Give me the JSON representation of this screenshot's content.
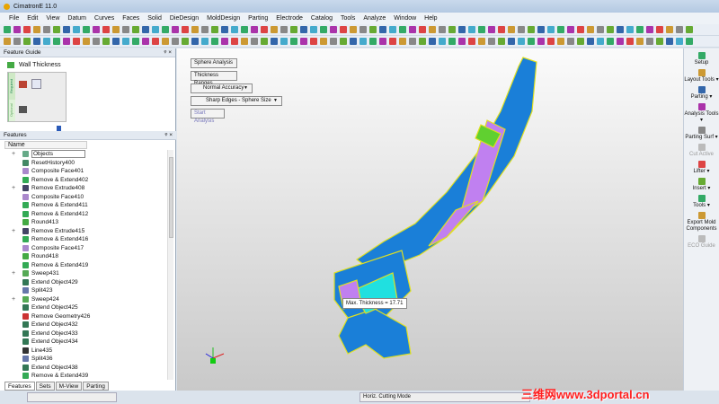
{
  "title": "CimatronE 11.0",
  "menu": [
    "File",
    "Edit",
    "View",
    "Datum",
    "Curves",
    "Faces",
    "Solid",
    "DieDesign",
    "MoldDesign",
    "Parting",
    "Electrode",
    "Catalog",
    "Tools",
    "Analyze",
    "Window",
    "Help"
  ],
  "feature_guide": {
    "title": "Feature Guide",
    "pin": "ᵠ ×",
    "tool": "Wall Thickness",
    "required": "Required",
    "optional": "Optional"
  },
  "features": {
    "title": "Features",
    "pin": "ᵠ ×",
    "column": "Name",
    "items": [
      {
        "label": "Objects",
        "expand": true,
        "color": "#6a8"
      },
      {
        "label": "ResetHistory400",
        "color": "#486"
      },
      {
        "label": "Composite Face401",
        "color": "#a8c"
      },
      {
        "label": "Remove & Extend402",
        "color": "#3a5"
      },
      {
        "label": "Remove Extrude408",
        "expand": true,
        "color": "#446"
      },
      {
        "label": "Composite Face410",
        "color": "#a8c"
      },
      {
        "label": "Remove & Extend411",
        "color": "#3a5"
      },
      {
        "label": "Remove & Extend412",
        "color": "#3a5"
      },
      {
        "label": "Round413",
        "color": "#4a4"
      },
      {
        "label": "Remove Extrude415",
        "expand": true,
        "color": "#446"
      },
      {
        "label": "Remove & Extend416",
        "color": "#3a5"
      },
      {
        "label": "Composite Face417",
        "color": "#a8c"
      },
      {
        "label": "Round418",
        "color": "#4a4"
      },
      {
        "label": "Remove & Extend419",
        "color": "#3a5"
      },
      {
        "label": "Sweep431",
        "expand": true,
        "color": "#5a5"
      },
      {
        "label": "Extend Object429",
        "color": "#375"
      },
      {
        "label": "Split423",
        "color": "#67a"
      },
      {
        "label": "Sweep424",
        "expand": true,
        "color": "#5a5"
      },
      {
        "label": "Extend Object425",
        "color": "#375"
      },
      {
        "label": "Remove Geometry426",
        "color": "#c33"
      },
      {
        "label": "Extend Object432",
        "color": "#375"
      },
      {
        "label": "Extend Object433",
        "color": "#375"
      },
      {
        "label": "Extend Object434",
        "color": "#375"
      },
      {
        "label": "Line435",
        "color": "#333"
      },
      {
        "label": "Split436",
        "color": "#67a"
      },
      {
        "label": "Extend Object438",
        "color": "#375"
      },
      {
        "label": "Remove & Extend439",
        "color": "#3a5"
      }
    ]
  },
  "tabs": [
    "Features",
    "Sets",
    "M-View",
    "Parting"
  ],
  "analysis": {
    "sphere": "Sphere Analysis",
    "ranges": "Thickness Ranges",
    "accuracy": "Normal Accuracy",
    "edges": "Sharp Edges - Sphere Size",
    "start": "Start Analysis",
    "tooltip": "Max. Thickness = 17.71"
  },
  "right_panel": [
    {
      "label": "Setup"
    },
    {
      "label": "Layout Tools",
      "dd": true
    },
    {
      "label": "Parting",
      "dd": true
    },
    {
      "label": "Analysis Tools",
      "dd": true
    },
    {
      "label": "Parting Surf",
      "dd": true
    },
    {
      "label": "Cut Active",
      "disabled": true
    },
    {
      "label": "Lifter",
      "dd": true
    },
    {
      "label": "Insert",
      "dd": true
    },
    {
      "label": "Tools",
      "dd": true
    },
    {
      "label": "Export Mold Components"
    },
    {
      "label": "ECO Guide",
      "disabled": true
    }
  ],
  "status": {
    "mode": "Horiz. Cutting Mode"
  },
  "watermark": "三维网www.3dportal.cn",
  "colors": {
    "part_blue": "#1a7fd8",
    "part_cyan": "#20e0e0",
    "part_violet": "#c080f0",
    "part_green": "#60d030",
    "edge": "#e0e020"
  }
}
